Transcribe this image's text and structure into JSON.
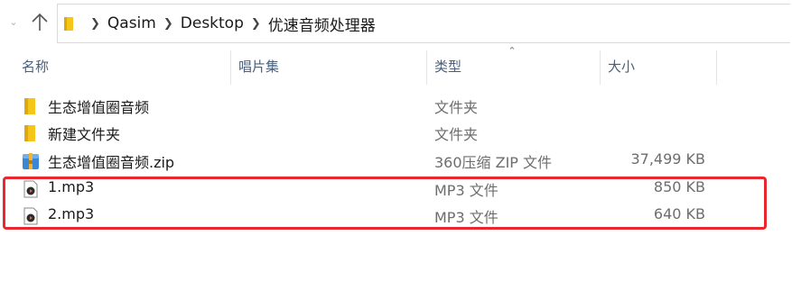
{
  "address": {
    "crumbs": [
      "Qasim",
      "Desktop",
      "优速音频处理器"
    ]
  },
  "columns": {
    "name": "名称",
    "album": "唱片集",
    "type": "类型",
    "size": "大小"
  },
  "files": [
    {
      "name": "生态增值圈音频",
      "type": "文件夹",
      "size": "",
      "icon": "folder-icon"
    },
    {
      "name": "新建文件夹",
      "type": "文件夹",
      "size": "",
      "icon": "folder-icon"
    },
    {
      "name": "生态增值圈音频.zip",
      "type": "360压缩 ZIP 文件",
      "size": "37,499 KB",
      "icon": "zip-archive-icon"
    },
    {
      "name": "1.mp3",
      "type": "MP3 文件",
      "size": "850 KB",
      "icon": "audio-file-icon"
    },
    {
      "name": "2.mp3",
      "type": "MP3 文件",
      "size": "640 KB",
      "icon": "audio-file-icon"
    }
  ],
  "colors": {
    "highlight": "#e8282e",
    "folder": "#f5c518",
    "header_text": "#4c607a"
  }
}
